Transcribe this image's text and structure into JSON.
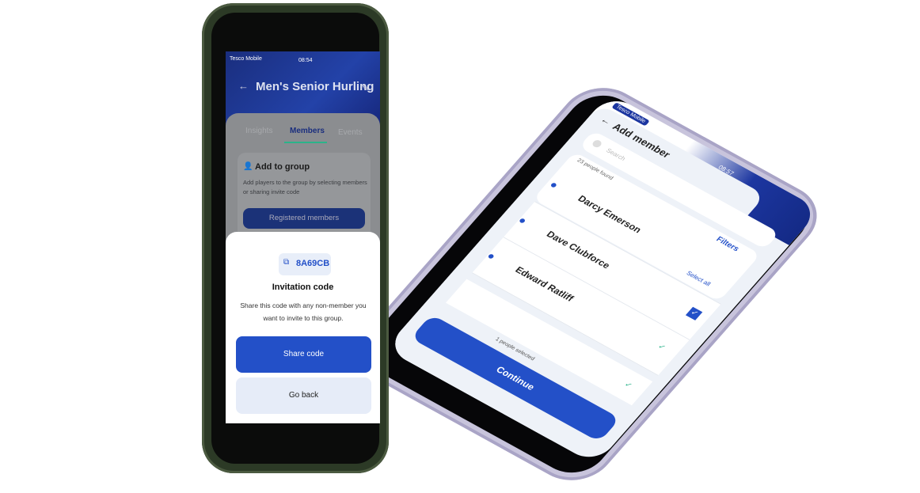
{
  "left_phone": {
    "status": {
      "carrier": "Tesco Mobile",
      "time": "08:54"
    },
    "header": {
      "title": "Men's Senior Hurling"
    },
    "tabs": [
      {
        "label": "Insights"
      },
      {
        "label": "Members",
        "active": true
      },
      {
        "label": "Events"
      }
    ],
    "add_group": {
      "title": "Add to group",
      "description": "Add players to the group by selecting members or sharing invite code",
      "button": "Registered members"
    },
    "sheet": {
      "code": "8A69CB",
      "title": "Invitation code",
      "description": "Share this code with any non-member you want to invite to this group.",
      "share_label": "Share code",
      "back_label": "Go back"
    }
  },
  "right_phone": {
    "status": {
      "carrier": "Tesco Mobile",
      "time": "08:57"
    },
    "header": {
      "title": "Add member"
    },
    "search": {
      "placeholder": "Search"
    },
    "filters_label": "Filters",
    "count": "23 people found",
    "select_all": "Select all",
    "members": [
      {
        "name": "Darcy Emerson",
        "selected": false
      },
      {
        "name": "Dave Clubforce",
        "selected": true
      },
      {
        "name": "Edward Ratliff",
        "selected": false
      }
    ],
    "selected_text": "1 people selected",
    "continue_label": "Continue"
  },
  "colors": {
    "primary": "#2350c8",
    "accent": "#2bb38a",
    "frame_left": "#2c3a26",
    "frame_right": "#c8c4dc"
  }
}
